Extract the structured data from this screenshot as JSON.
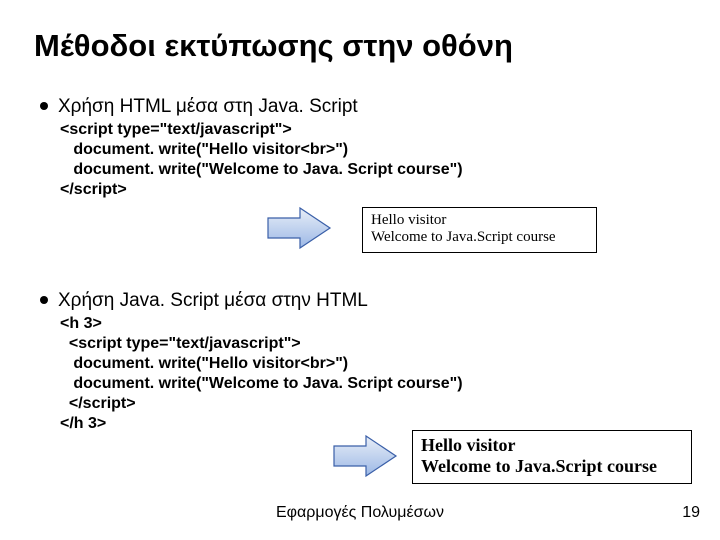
{
  "title": "Μέθοδοι εκτύπωσης στην οθόνη",
  "section1": {
    "heading": "Χρήση HTML μέσα στη Java. Script",
    "code": "<script type=\"text/javascript\">\n   document. write(\"Hello visitor<br>\")\n   document. write(\"Welcome to Java. Script course\")\n</script>",
    "output_line1": "Hello visitor",
    "output_line2": "Welcome to Java.Script course"
  },
  "section2": {
    "heading": "Χρήση Java. Script μέσα στην HTML",
    "code": "<h 3>\n  <script type=\"text/javascript\">\n   document. write(\"Hello visitor<br>\")\n   document. write(\"Welcome to Java. Script course\")\n  </script>\n</h 3>",
    "output_line1": "Hello visitor",
    "output_line2": "Welcome to Java.Script course"
  },
  "footer": "Εφαρμογές Πολυμέσων",
  "page": "19"
}
